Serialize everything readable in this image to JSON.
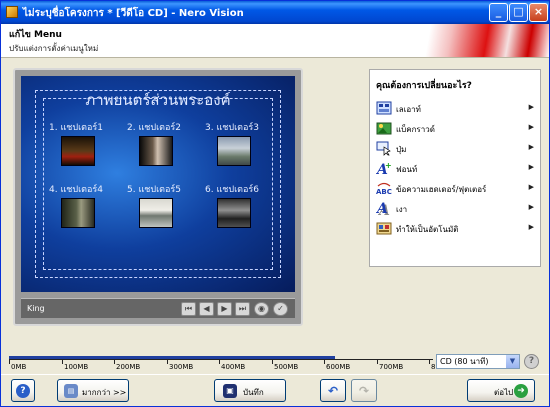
{
  "window": {
    "title": "ไม่ระบุชื่อโครงการ * [วีดีโอ CD] - Nero Vision"
  },
  "header": {
    "title": "แก้ไข Menu",
    "subtitle": "ปรับแต่งการตั้งค่าเมนูใหม่"
  },
  "menu_preview": {
    "title": "ภาพยนตร์ส่วนพระองค์",
    "chapters": [
      "1. แชปเตอร์1",
      "2. แชปเตอร์2",
      "3. แชปเตอร์3",
      "4. แชปเตอร์4",
      "5. แชปเตอร์5",
      "6. แชปเตอร์6"
    ],
    "bar_label": "King"
  },
  "side_panel": {
    "heading": "คุณต้องการเปลี่ยนอะไร?",
    "items": [
      {
        "label": "เลเอาท์",
        "icon": "layout-icon"
      },
      {
        "label": "แบ็คกราวด์",
        "icon": "background-icon"
      },
      {
        "label": "ปุ่ม",
        "icon": "buttons-icon"
      },
      {
        "label": "ฟอนท์",
        "icon": "font-icon"
      },
      {
        "label": "ข้อความเฮดเดอร์/ฟุตเตอร์",
        "icon": "header-footer-text-icon"
      },
      {
        "label": "เงา",
        "icon": "shadow-icon"
      },
      {
        "label": "ทำให้เป็นอัตโนมัติ",
        "icon": "automate-icon"
      }
    ]
  },
  "capacity": {
    "ticks": [
      "0MB",
      "100MB",
      "200MB",
      "300MB",
      "400MB",
      "500MB",
      "600MB",
      "700MB",
      "800MB"
    ],
    "used_mb": 620,
    "disc_type": "CD (80 นาที)"
  },
  "buttons": {
    "more": "มากกว่า >>",
    "save": "บันทึก",
    "next": "ต่อไป"
  }
}
